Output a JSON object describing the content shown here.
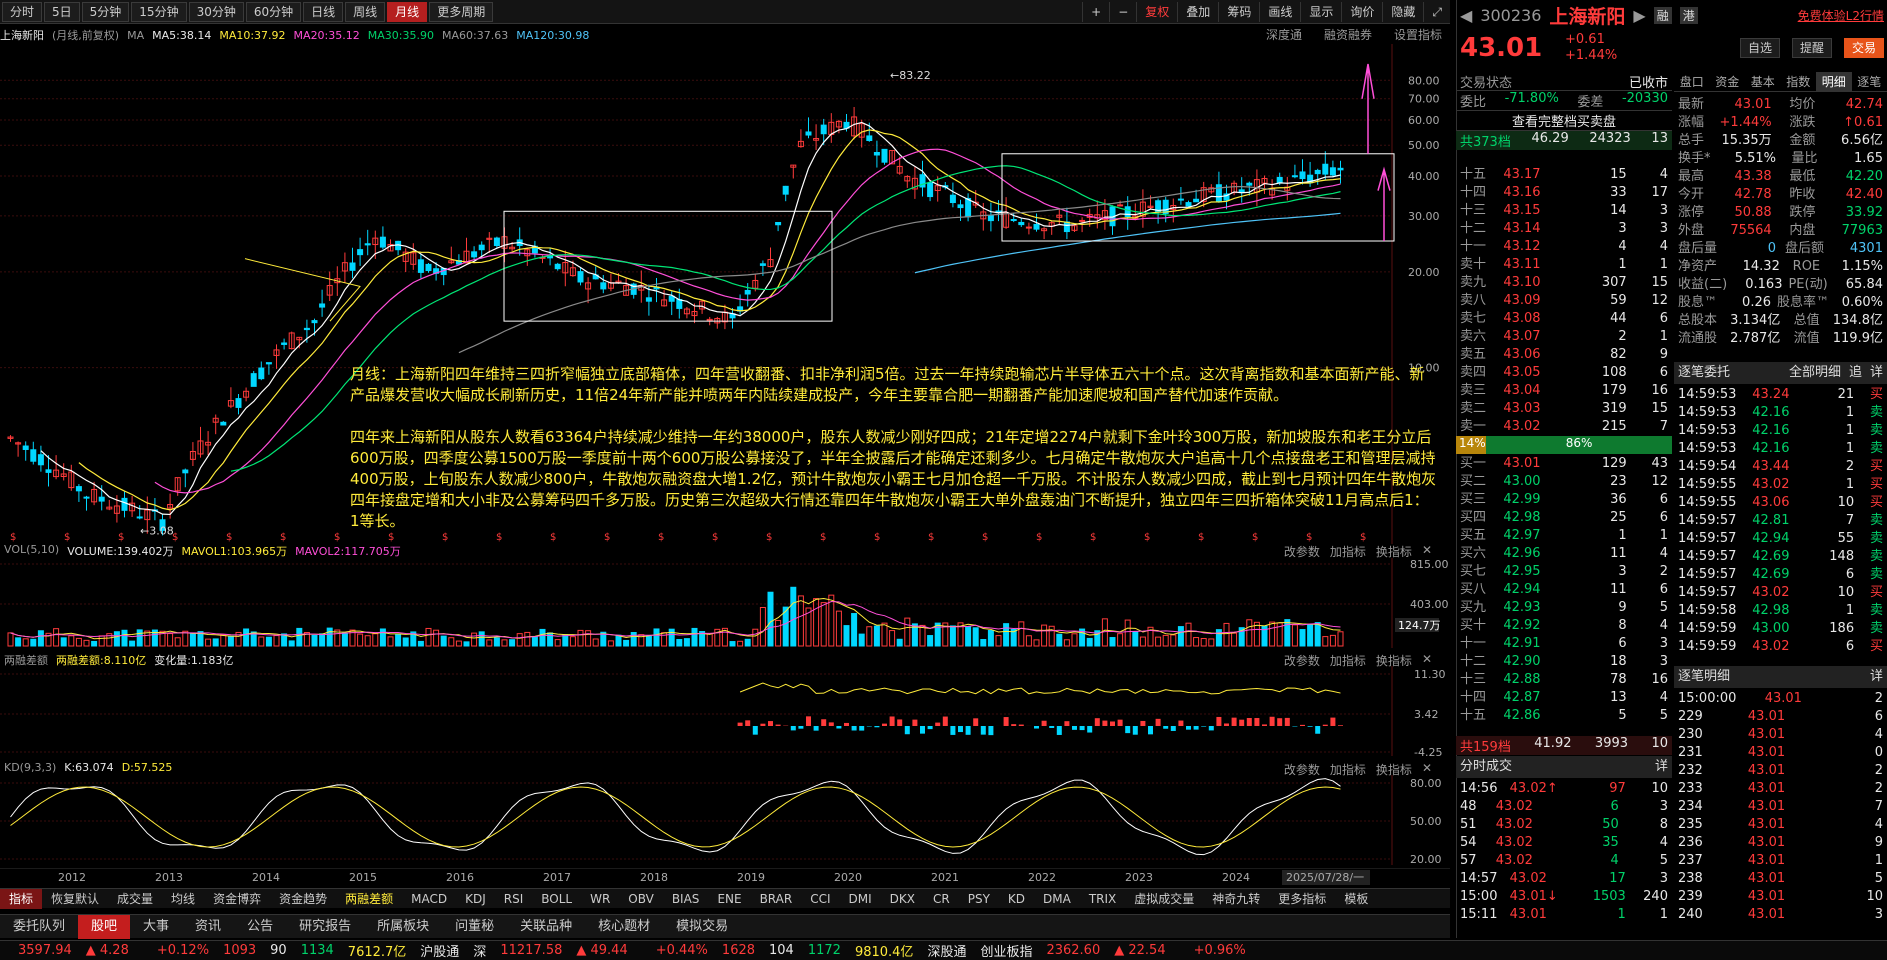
{
  "toolbar": {
    "periods": [
      "分时",
      "5日",
      "5分钟",
      "15分钟",
      "30分钟",
      "60分钟",
      "日线",
      "周线",
      "月线",
      "更多周期"
    ],
    "active_period": "月线",
    "tools": [
      "复权",
      "叠加",
      "筹码",
      "画线",
      "显示",
      "询价",
      "隐藏"
    ]
  },
  "ma_bar": {
    "name": "上海新阳",
    "mode": "(月线,前复权)",
    "ma": "MA",
    "ma5": "MA5:38.14",
    "ma10": "MA10:37.92",
    "ma20": "MA20:35.12",
    "ma30": "MA30:35.90",
    "ma60": "MA60:37.63",
    "ma120": "MA120:30.98",
    "right_tools": [
      "深度通",
      "融资融券",
      "设置指标"
    ]
  },
  "price_axis": [
    "80.00",
    "70.00",
    "60.00",
    "50.00",
    "40.00",
    "30.00",
    "20.00",
    "10.00"
  ],
  "price_marks": {
    "high": "83.22",
    "low": "3.08"
  },
  "annotation": {
    "p1": "月线：上海新阳四年维持三四折窄幅独立底部箱体，四年营收翻番、扣非净利润5倍。过去一年持续跑输芯片半导体五六十个点。这次背离指数和基本面新产能、新产品爆发营收大幅成长刷新历史，11倍24年新产能并喷两年内陆续建成投产，今年主要靠合肥一期翻番产能加速爬坡和国产替代加速作贡献。",
    "p2": "四年来上海新阳从股东人数看63364户持续减少维持一年约38000户，股东人数减少刚好四成；21年定增2274户就剩下金叶玲300万股，新加坡股东和老王分立后600万股，四季度公募1500万股一季度前十两个600万股公募接没了，半年全披露后才能确定还剩多少。七月确定牛散炮灰大户追高十几个点接盘老王和管理层减持400万股，上旬股东人数减少800户，牛散炮灰融资盘大增1.2亿，预计牛散炮灰小霸王七月加仓超一千万股。不计股东人数减少四成，截止到七月预计四年牛散炮灰四年接盘定增和大小非及公募筹码四千多万股。历史第三次超级大行情还靠四年牛散炮灰小霸王大单外盘轰油门不断提升，独立四年三四折箱体突破11月高点后1：1等长。"
  },
  "vol_pane": {
    "label": "VOL(5,10)",
    "volume": "VOLUME:139.402万",
    "mavol1": "MAVOL1:103.965万",
    "mavol2": "MAVOL2:117.705万",
    "axis": [
      "815.00",
      "403.00"
    ],
    "last": "124.7万",
    "tools": [
      "改参数",
      "加指标",
      "换指标"
    ]
  },
  "margin_pane": {
    "label": "两融差额",
    "value": "两融差额:8.110亿",
    "change": "变化量:1.183亿",
    "axis": [
      "11.30",
      "3.42",
      "-4.25"
    ],
    "tools": [
      "改参数",
      "加指标",
      "换指标"
    ]
  },
  "kd_pane": {
    "label": "KD(9,3,3)",
    "k": "K:63.074",
    "d": "D:57.525",
    "axis": [
      "80.00",
      "50.00",
      "20.00"
    ],
    "tools": [
      "改参数",
      "加指标",
      "换指标"
    ]
  },
  "x_axis": [
    "2012",
    "2013",
    "2014",
    "2015",
    "2016",
    "2017",
    "2018",
    "2019",
    "2020",
    "2021",
    "2022",
    "2023",
    "2024"
  ],
  "x_cursor": "2025/07/28/一",
  "indicator_tabs": [
    "指标",
    "恢复默认",
    "成交量",
    "均线",
    "资金博弈",
    "资金趋势",
    "两融差额",
    "MACD",
    "KDJ",
    "RSI",
    "BOLL",
    "WR",
    "OBV",
    "BIAS",
    "ENE",
    "BRAR",
    "CCI",
    "DMI",
    "DKX",
    "CR",
    "PSY",
    "KD",
    "DMA",
    "TRIX",
    "虚拟成交量",
    "神奇九转",
    "更多指标",
    "模板"
  ],
  "bottom_tabs": [
    "委托队列",
    "股吧",
    "大事",
    "资讯",
    "公告",
    "研究报告",
    "所属板块",
    "问董秘",
    "关联品种",
    "核心题材",
    "模拟交易"
  ],
  "status": {
    "sh": "3597.94",
    "sh_chg": "4.28",
    "sh_pct": "+0.12%",
    "sh_up": "1093",
    "sh_eq": "90",
    "sh_dn": "1134",
    "sh_amt": "7612.7亿",
    "hgt": "沪股通",
    "sz_label": "深",
    "sz": "11217.58",
    "sz_chg": "49.44",
    "sz_pct": "+0.44%",
    "sz_up": "1628",
    "sz_eq": "104",
    "sz_dn": "1172",
    "sz_amt": "9810.4亿",
    "sgt": "深股通",
    "cyb": "创业板指",
    "cyb_v": "2362.60",
    "cyb_chg": "22.54",
    "cyb_pct": "+0.96%"
  },
  "quote": {
    "code": "300236",
    "name": "上海新阳",
    "tags": [
      "融",
      "港"
    ],
    "l2": "免费体验L2行情",
    "price": "43.01",
    "change": "+0.61",
    "pct": "+1.44%",
    "buttons": [
      "自选",
      "提醒",
      "交易"
    ],
    "state_label": "交易状态",
    "state": "已收市",
    "weibi_label": "委比",
    "weibi": "-71.80%",
    "weicha_label": "委差",
    "weicha": "-20330",
    "full_btn": "查看完整档买卖盘",
    "total_sell": [
      "共373档",
      "46.29",
      "24323",
      "13"
    ],
    "total_buy": [
      "共159档",
      "41.92",
      "3993",
      "10"
    ],
    "ratio": [
      "14%",
      "86%"
    ],
    "right_tabs": [
      "盘口",
      "资金",
      "基本",
      "指数",
      "明细",
      "逐笔"
    ],
    "active_tab": "明细"
  },
  "sell_levels": [
    [
      "十五",
      "43.17",
      "15",
      "4"
    ],
    [
      "十四",
      "43.16",
      "33",
      "17"
    ],
    [
      "十三",
      "43.15",
      "14",
      "3"
    ],
    [
      "十二",
      "43.14",
      "3",
      "3"
    ],
    [
      "十一",
      "43.12",
      "4",
      "4"
    ],
    [
      "卖十",
      "43.11",
      "1",
      "1"
    ],
    [
      "卖九",
      "43.10",
      "307",
      "15"
    ],
    [
      "卖八",
      "43.09",
      "59",
      "12"
    ],
    [
      "卖七",
      "43.08",
      "44",
      "6"
    ],
    [
      "卖六",
      "43.07",
      "2",
      "1"
    ],
    [
      "卖五",
      "43.06",
      "82",
      "9"
    ],
    [
      "卖四",
      "43.05",
      "108",
      "6"
    ],
    [
      "卖三",
      "43.04",
      "179",
      "16"
    ],
    [
      "卖二",
      "43.03",
      "319",
      "15"
    ],
    [
      "卖一",
      "43.02",
      "215",
      "7"
    ]
  ],
  "buy_levels": [
    [
      "买一",
      "43.01",
      "129",
      "43"
    ],
    [
      "买二",
      "43.00",
      "23",
      "12"
    ],
    [
      "买三",
      "42.99",
      "36",
      "6"
    ],
    [
      "买四",
      "42.98",
      "25",
      "6"
    ],
    [
      "买五",
      "42.97",
      "1",
      "1"
    ],
    [
      "买六",
      "42.96",
      "11",
      "4"
    ],
    [
      "买七",
      "42.95",
      "3",
      "2"
    ],
    [
      "买八",
      "42.94",
      "11",
      "6"
    ],
    [
      "买九",
      "42.93",
      "9",
      "5"
    ],
    [
      "买十",
      "42.92",
      "8",
      "4"
    ],
    [
      "十一",
      "42.91",
      "6",
      "3"
    ],
    [
      "十二",
      "42.90",
      "18",
      "3"
    ],
    [
      "十三",
      "42.88",
      "78",
      "16"
    ],
    [
      "十四",
      "42.87",
      "13",
      "4"
    ],
    [
      "十五",
      "42.86",
      "5",
      "5"
    ]
  ],
  "stats": [
    [
      "最新",
      "43.01",
      "均价",
      "42.74"
    ],
    [
      "涨幅",
      "+1.44%",
      "涨跌",
      "↑0.61"
    ],
    [
      "总手",
      "15.35万",
      "金额",
      "6.56亿"
    ],
    [
      "换手*",
      "5.51%",
      "量比",
      "1.65"
    ],
    [
      "最高",
      "43.38",
      "最低",
      "42.20"
    ],
    [
      "今开",
      "42.78",
      "昨收",
      "42.40"
    ],
    [
      "涨停",
      "50.88",
      "跌停",
      "33.92"
    ],
    [
      "外盘",
      "75564",
      "内盘",
      "77963"
    ],
    [
      "盘后量",
      "0",
      "盘后额",
      "4301"
    ],
    [
      "净资产",
      "14.32",
      "ROE",
      "1.15%"
    ],
    [
      "收益(二)",
      "0.163",
      "PE(动)",
      "65.84"
    ],
    [
      "股息™",
      "0.26",
      "股息率™",
      "0.60%"
    ],
    [
      "总股本",
      "3.134亿",
      "总值",
      "134.8亿"
    ],
    [
      "流通股",
      "2.787亿",
      "流值",
      "119.9亿"
    ]
  ],
  "entrust": {
    "title": "逐笔委托",
    "filter": "全部明细",
    "btns": [
      "追",
      "详"
    ],
    "rows": [
      [
        "14:59:53",
        "43.24",
        "21",
        "买"
      ],
      [
        "14:59:53",
        "42.16",
        "1",
        "卖"
      ],
      [
        "14:59:53",
        "42.16",
        "1",
        "卖"
      ],
      [
        "14:59:53",
        "42.16",
        "1",
        "卖"
      ],
      [
        "14:59:54",
        "43.44",
        "2",
        "买"
      ],
      [
        "14:59:55",
        "43.02",
        "1",
        "买"
      ],
      [
        "14:59:55",
        "43.06",
        "10",
        "买"
      ],
      [
        "14:59:57",
        "42.81",
        "7",
        "卖"
      ],
      [
        "14:59:57",
        "42.94",
        "55",
        "卖"
      ],
      [
        "14:59:57",
        "42.69",
        "148",
        "卖"
      ],
      [
        "14:59:57",
        "42.69",
        "6",
        "卖"
      ],
      [
        "14:59:57",
        "43.02",
        "10",
        "买"
      ],
      [
        "14:59:58",
        "42.98",
        "1",
        "卖"
      ],
      [
        "14:59:59",
        "43.00",
        "186",
        "卖"
      ],
      [
        "14:59:59",
        "43.02",
        "6",
        "买"
      ]
    ]
  },
  "detail": {
    "title": "逐笔明细",
    "btn": "详",
    "rows": [
      [
        "15:00:00",
        "43.01",
        "2"
      ],
      [
        "229",
        "43.01",
        "6"
      ],
      [
        "230",
        "43.01",
        "4"
      ],
      [
        "231",
        "43.01",
        "0"
      ],
      [
        "232",
        "43.01",
        "2"
      ],
      [
        "233",
        "43.01",
        "2"
      ],
      [
        "234",
        "43.01",
        "7"
      ],
      [
        "235",
        "43.01",
        "4"
      ],
      [
        "236",
        "43.01",
        "9"
      ],
      [
        "237",
        "43.01",
        "1"
      ],
      [
        "238",
        "43.01",
        "5"
      ],
      [
        "239",
        "43.01",
        "10"
      ],
      [
        "240",
        "43.01",
        "3"
      ]
    ]
  },
  "ticks": {
    "title": "分时成交",
    "btn": "详",
    "rows": [
      [
        "14:56",
        "43.02↑",
        "97",
        "10"
      ],
      [
        "48",
        "43.02",
        "6",
        "3"
      ],
      [
        "51",
        "43.02",
        "50",
        "8"
      ],
      [
        "54",
        "43.02",
        "35",
        "4"
      ],
      [
        "57",
        "43.02",
        "4",
        "5"
      ],
      [
        "14:57",
        "43.02",
        "17",
        "3"
      ],
      [
        "15:00",
        "43.01↓",
        "1503",
        "240"
      ],
      [
        "15:11",
        "43.01",
        "1",
        "1"
      ]
    ]
  },
  "colors": {
    "up": "#ff3b3b",
    "down": "#00d26a",
    "ma5": "#ffffff",
    "ma10": "#ffeb3b",
    "ma20": "#ff4fd8",
    "ma30": "#00e676",
    "ma60": "#8a8a8a",
    "ma120": "#4fc3f7"
  }
}
